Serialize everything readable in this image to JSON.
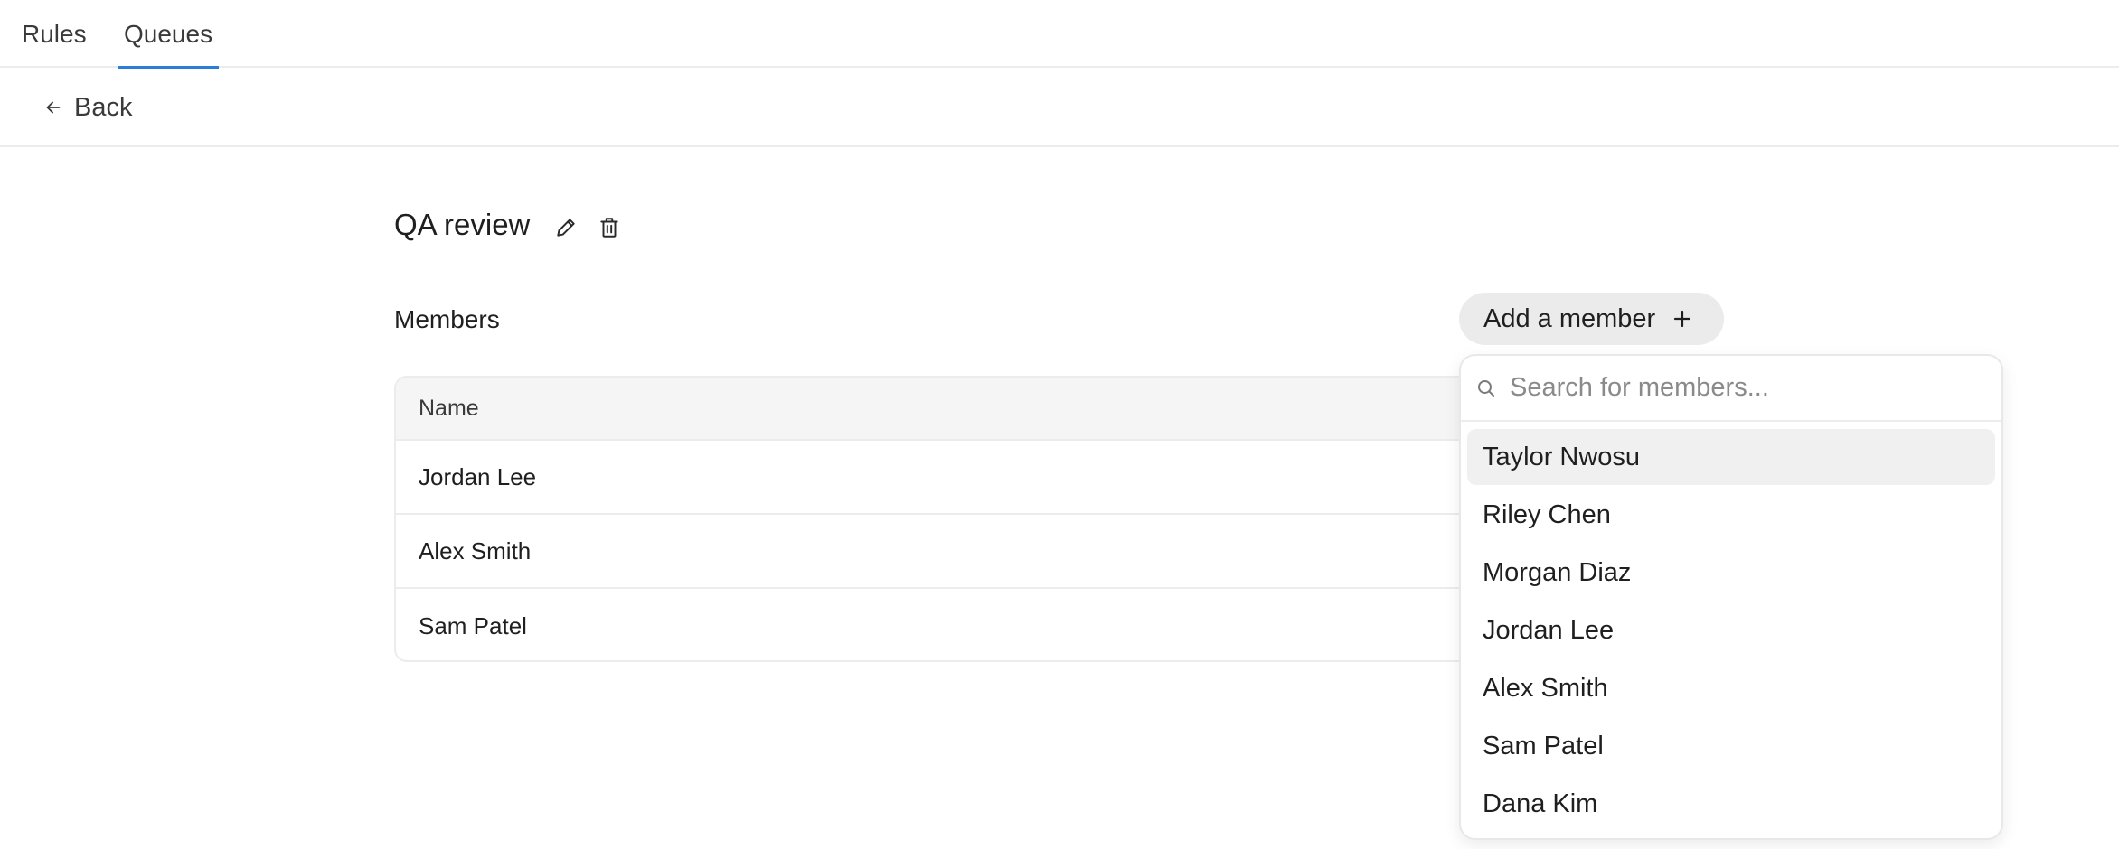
{
  "tabs": {
    "rules": "Rules",
    "queues": "Queues"
  },
  "back_label": "Back",
  "queue": {
    "title": "QA review"
  },
  "members_label": "Members",
  "add_member_label": "Add a member",
  "table": {
    "column_name": "Name",
    "rows": [
      "Jordan Lee",
      "Alex Smith",
      "Sam Patel"
    ]
  },
  "dropdown": {
    "search_placeholder": "Search for members...",
    "options": [
      "Taylor Nwosu",
      "Riley Chen",
      "Morgan Diaz",
      "Jordan Lee",
      "Alex Smith",
      "Sam Patel",
      "Dana Kim"
    ],
    "highlighted": "Taylor Nwosu"
  },
  "colors": {
    "accent": "#2b7fd9",
    "pill_bg": "#ebebeb"
  },
  "icons": [
    "arrow-left-icon",
    "pencil-icon",
    "trash-icon",
    "plus-icon",
    "search-icon"
  ]
}
